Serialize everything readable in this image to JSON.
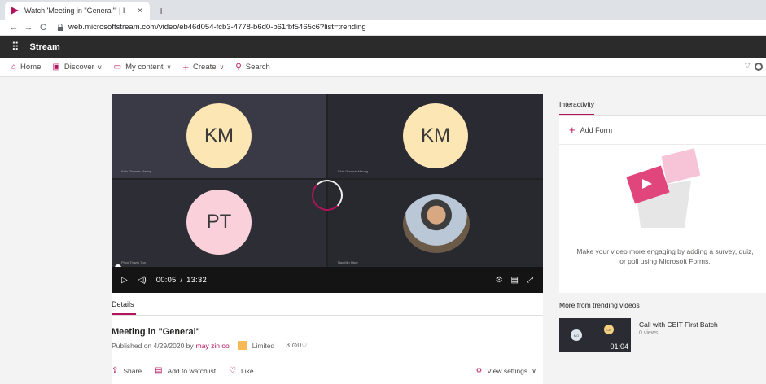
{
  "browser": {
    "tab_title": "Watch 'Meeting in \"General\"' | I",
    "tab_close": "×",
    "new_tab": "+",
    "back": "←",
    "forward": "→",
    "reload": "C",
    "url": "web.microsoftstream.com/video/eb46d054-fcb3-4778-b6d0-b61fbf5465c6?list=trending"
  },
  "app": {
    "name": "Stream"
  },
  "nav": {
    "home": "Home",
    "discover": "Discover",
    "my_content": "My content",
    "create": "Create",
    "search": "Search"
  },
  "video": {
    "tiles": [
      {
        "initials": "KM",
        "name": "Khin Ohnmar Maung"
      },
      {
        "initials": "KM",
        "name": "Khin Ohnmar Maung"
      },
      {
        "initials": "PT",
        "name": "Phyu Thazin Tun"
      },
      {
        "initials": "",
        "name": "Nay Min Htwe"
      }
    ],
    "current_time": "00:05",
    "separator": "/",
    "duration": "13:32",
    "progress_fraction": 0.006
  },
  "details": {
    "tab_label": "Details",
    "title": "Meeting in \"General\"",
    "published_prefix": "Published on 4/29/2020 by",
    "author": "may zin oo",
    "privacy": "Limited",
    "views": "3",
    "likes": "0",
    "actions": {
      "share": "Share",
      "watchlist": "Add to watchlist",
      "like": "Like",
      "more": "...",
      "view_settings": "View settings"
    }
  },
  "interactivity": {
    "title": "Interactivity",
    "add_form": "Add Form",
    "description": "Make your video more engaging by adding a survey, quiz, or poll using Microsoft Forms."
  },
  "trending": {
    "title": "More from trending videos",
    "items": [
      {
        "name": "Call with CEIT First Batch",
        "views": "0 views",
        "duration": "01:04",
        "avatar1": "MO",
        "avatar2": "CB"
      }
    ]
  },
  "colors": {
    "accent": "#b4135d",
    "dark_bar": "#2b2b2b"
  }
}
